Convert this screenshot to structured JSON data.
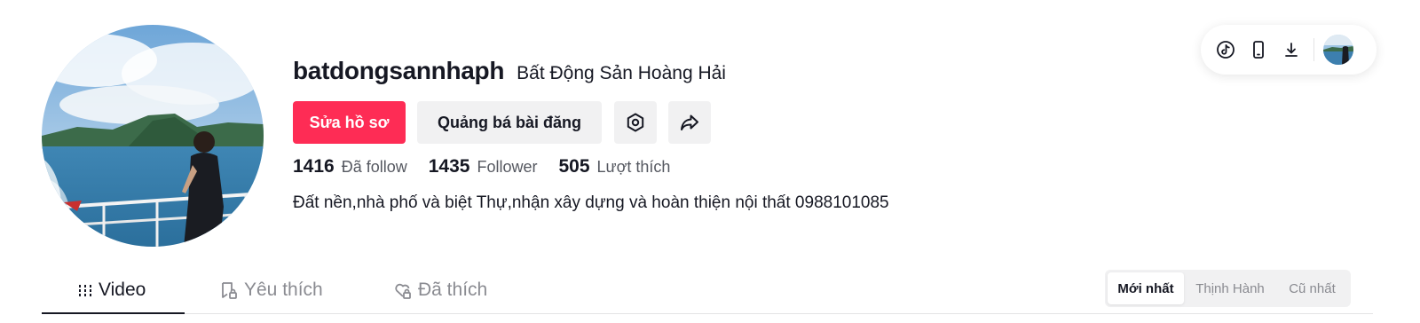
{
  "profile": {
    "username": "batdongsannhaph",
    "nickname": "Bất Động Sản Hoàng Hải",
    "bio": "Đất nền,nhà phố và biệt Thự,nhận xây dựng và hoàn thiện nội thất 0988101085"
  },
  "actions": {
    "edit_profile": "Sửa hồ sơ",
    "promote_post": "Quảng bá bài đăng",
    "settings_icon": "gear-icon",
    "share_icon": "share-arrow-icon"
  },
  "stats": {
    "following": {
      "count": "1416",
      "label": "Đã follow"
    },
    "followers": {
      "count": "1435",
      "label": "Follower"
    },
    "likes": {
      "count": "505",
      "label": "Lượt thích"
    }
  },
  "toolbar": {
    "icons": [
      "tiktok-logo-icon",
      "mobile-icon",
      "download-icon",
      "user-avatar"
    ]
  },
  "tabs": [
    {
      "label": "Video",
      "icon": "grid-icon",
      "active": true
    },
    {
      "label": "Yêu thích",
      "icon": "bookmark-lock-icon",
      "active": false
    },
    {
      "label": "Đã thích",
      "icon": "heart-lock-icon",
      "active": false
    }
  ],
  "sort": {
    "options": [
      "Mới nhất",
      "Thịnh Hành",
      "Cũ nhất"
    ],
    "selected": "Mới nhất"
  },
  "colors": {
    "primary": "#fe2c55",
    "text": "#161823",
    "muted": "#8a8b91",
    "surface": "#f1f1f2"
  }
}
